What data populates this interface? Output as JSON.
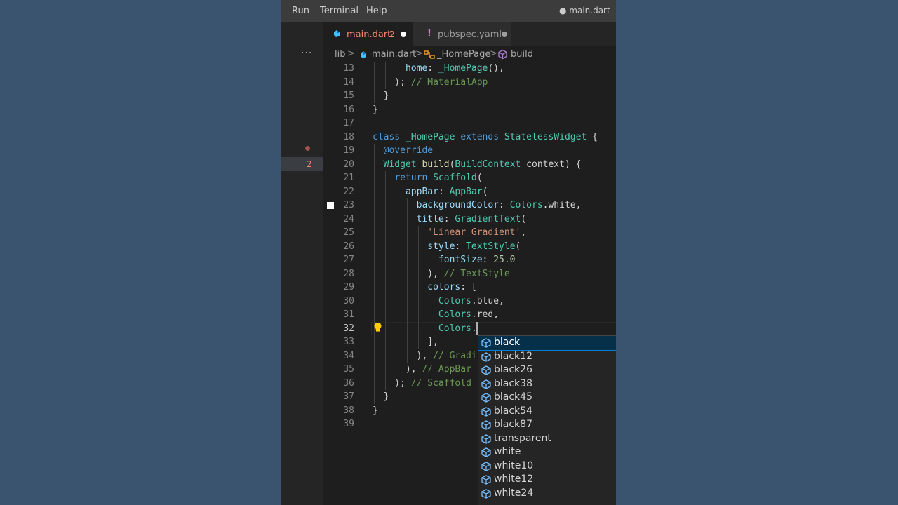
{
  "menu": {
    "items": [
      "Run",
      "Terminal",
      "Help"
    ],
    "window_title": "● main.dart - sl"
  },
  "activity": {
    "more": "···"
  },
  "tabs": [
    {
      "icon": "dart-icon",
      "label": "main.dart",
      "badge": "2",
      "modified": true,
      "active": true
    },
    {
      "icon": "yaml-exclamation-icon",
      "icon_glyph": "!",
      "label": "pubspec.yaml",
      "modified": true,
      "active": false
    }
  ],
  "breadcrumb": {
    "items": [
      "lib",
      "main.dart",
      "_HomePage",
      "build"
    ],
    "separator": ">"
  },
  "gutter": {
    "error_count": "2",
    "current_line": 32
  },
  "code": {
    "lines": [
      {
        "n": "13",
        "text": "      home: _HomePage(),"
      },
      {
        "n": "14",
        "text": "    ); // MaterialApp"
      },
      {
        "n": "15",
        "text": "  }"
      },
      {
        "n": "16",
        "text": "}"
      },
      {
        "n": "17",
        "text": ""
      },
      {
        "n": "18",
        "text": "class _HomePage extends StatelessWidget {"
      },
      {
        "n": "19",
        "text": "  @override"
      },
      {
        "n": "20",
        "text": "  Widget build(BuildContext context) {"
      },
      {
        "n": "21",
        "text": "    return Scaffold("
      },
      {
        "n": "22",
        "text": "      appBar: AppBar("
      },
      {
        "n": "23",
        "text": "        backgroundColor: Colors.white,"
      },
      {
        "n": "24",
        "text": "        title: GradientText("
      },
      {
        "n": "25",
        "text": "          'Linear Gradient',"
      },
      {
        "n": "26",
        "text": "          style: TextStyle("
      },
      {
        "n": "27",
        "text": "            fontSize: 25.0"
      },
      {
        "n": "28",
        "text": "          ), // TextStyle"
      },
      {
        "n": "29",
        "text": "          colors: ["
      },
      {
        "n": "30",
        "text": "            Colors.blue,"
      },
      {
        "n": "31",
        "text": "            Colors.red,"
      },
      {
        "n": "32",
        "text": "            Colors."
      },
      {
        "n": "33",
        "text": "          ],"
      },
      {
        "n": "34",
        "text": "        ), // Gradi"
      },
      {
        "n": "35",
        "text": "      ), // AppBar"
      },
      {
        "n": "36",
        "text": "    ); // Scaffold"
      },
      {
        "n": "37",
        "text": "  }"
      },
      {
        "n": "38",
        "text": "}"
      },
      {
        "n": "39",
        "text": ""
      }
    ]
  },
  "suggestions": {
    "selected_index": 0,
    "items": [
      "black",
      "black12",
      "black26",
      "black38",
      "black45",
      "black54",
      "black87",
      "transparent",
      "white",
      "white10",
      "white12",
      "white24"
    ]
  },
  "colors": {
    "keyword": "#569cd6",
    "type": "#4ec9b0",
    "function": "#dcdcaa",
    "property": "#9cdcfe",
    "string": "#ce9178",
    "number": "#b5cea8",
    "comment": "#6a9955",
    "default": "#d4d4d4",
    "accent": "#007fd4",
    "error": "#f48771"
  }
}
